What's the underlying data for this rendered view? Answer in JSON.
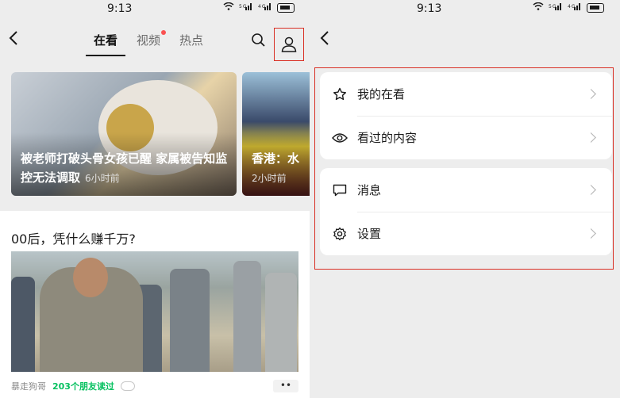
{
  "left_screen": {
    "status": {
      "time": "9:13",
      "network": "5G 4G"
    },
    "header": {
      "tabs": [
        {
          "label": "在看",
          "active": true
        },
        {
          "label": "视频",
          "active": false,
          "has_dot": true
        },
        {
          "label": "热点",
          "active": false
        }
      ],
      "search_icon": "search-icon",
      "profile_icon": "user-icon"
    },
    "hero_cards": [
      {
        "title": "被老师打破头骨女孩已醒 家属被告知监控无法调取",
        "time": "6小时前"
      },
      {
        "title": "香港：水",
        "time": "2小时前"
      }
    ],
    "article": {
      "title": "00后，凭什么赚千万?",
      "author": "暴走狗哥",
      "friends_read": "203个朋友读过",
      "more_label": "••"
    }
  },
  "right_screen": {
    "status": {
      "time": "9:13",
      "network": "5G 4G"
    },
    "menu_groups": [
      {
        "items": [
          {
            "label": "我的在看",
            "icon": "star-icon"
          },
          {
            "label": "看过的内容",
            "icon": "eye-icon"
          }
        ]
      },
      {
        "items": [
          {
            "label": "消息",
            "icon": "message-icon"
          },
          {
            "label": "设置",
            "icon": "gear-icon"
          }
        ]
      }
    ]
  },
  "colors": {
    "accent_green": "#07c160",
    "highlight_red": "#d93025",
    "notification_dot": "#fa5151"
  }
}
